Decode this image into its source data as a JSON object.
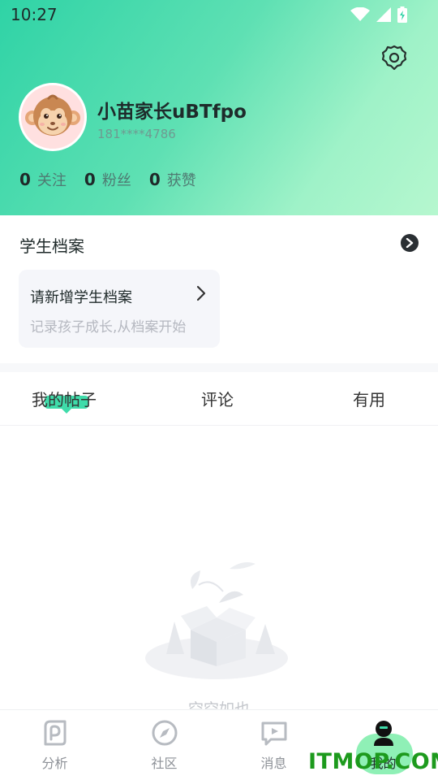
{
  "status_bar": {
    "time": "10:27"
  },
  "profile": {
    "username": "小苗家长uBTfpo",
    "phone": "181****4786",
    "stats": [
      {
        "count": "0",
        "label": "关注"
      },
      {
        "count": "0",
        "label": "粉丝"
      },
      {
        "count": "0",
        "label": "获赞"
      }
    ]
  },
  "student_file": {
    "title": "学生档案",
    "add_title": "请新增学生档案",
    "add_subtitle": "记录孩子成长,从档案开始"
  },
  "tabs": [
    {
      "label": "我的帖子",
      "active": true
    },
    {
      "label": "评论",
      "active": false
    },
    {
      "label": "有用",
      "active": false
    }
  ],
  "empty_state": {
    "text": "空空如也"
  },
  "bottom_nav": [
    {
      "label": "分析",
      "icon": "analysis-icon",
      "active": false
    },
    {
      "label": "社区",
      "icon": "compass-icon",
      "active": false
    },
    {
      "label": "消息",
      "icon": "message-icon",
      "active": false
    },
    {
      "label": "我的",
      "icon": "profile-icon",
      "active": true
    }
  ],
  "watermark": "ITMOP.COM",
  "colors": {
    "accent": "#3fdcaa",
    "header_gradient_start": "#2fd3a6",
    "header_gradient_end": "#b6f7cf",
    "nav_active_bg": "#8ff0b6",
    "watermark": "#1d9a1d"
  }
}
